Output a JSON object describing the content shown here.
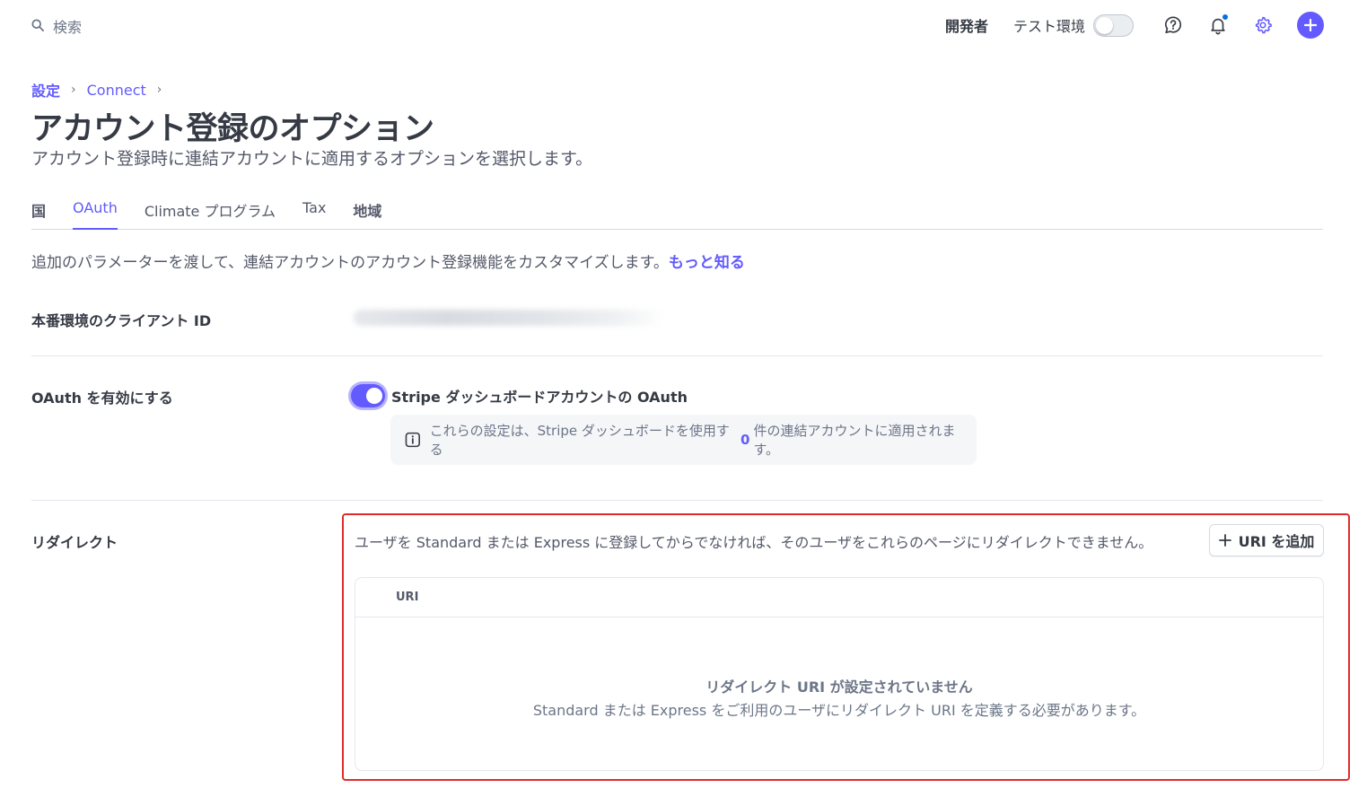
{
  "search": {
    "placeholder": "検索",
    "icon": "search-icon"
  },
  "topbar": {
    "developers_label": "開発者",
    "test_mode_label": "テスト環境",
    "test_mode_on": false,
    "icons": [
      "help-icon",
      "bell-icon",
      "gear-icon",
      "plus-icon"
    ],
    "accent_color": "#635bff"
  },
  "breadcrumb": {
    "items": [
      "設定",
      "Connect"
    ]
  },
  "page": {
    "title": "アカウント登録のオプション",
    "subtitle": "アカウント登録時に連結アカウントに適用するオプションを選択します。"
  },
  "tabs": [
    {
      "label": "国",
      "active": false
    },
    {
      "label": "OAuth",
      "active": true
    },
    {
      "label": "Climate プログラム",
      "active": false
    },
    {
      "label": "Tax",
      "active": false
    },
    {
      "label": "地域",
      "active": false
    }
  ],
  "intro": {
    "text": "追加のパラメーターを渡して、連結アカウントのアカウント登録機能をカスタマイズします。",
    "learn_more": "もっと知る"
  },
  "client_id": {
    "label": "本番環境のクライアント ID"
  },
  "oauth": {
    "label": "OAuth を有効にする",
    "toggle_label": "Stripe ダッシュボードアカウントの OAuth",
    "enabled": true,
    "info_prefix": "これらの設定は、Stripe ダッシュボードを使用する",
    "info_count": "0",
    "info_suffix": "件の連結アカウントに適用されます。"
  },
  "redirect": {
    "label": "リダイレクト",
    "description": "ユーザを Standard または Express に登録してからでなければ、そのユーザをこれらのページにリダイレクトできません。",
    "add_button": "URI を追加",
    "table_header": "URI",
    "empty_title": "リダイレクト URI が設定されていません",
    "empty_subtitle": "Standard または Express をご利用のユーザにリダイレクト URI を定義する必要があります。",
    "highlight_color": "#e02b2b"
  }
}
